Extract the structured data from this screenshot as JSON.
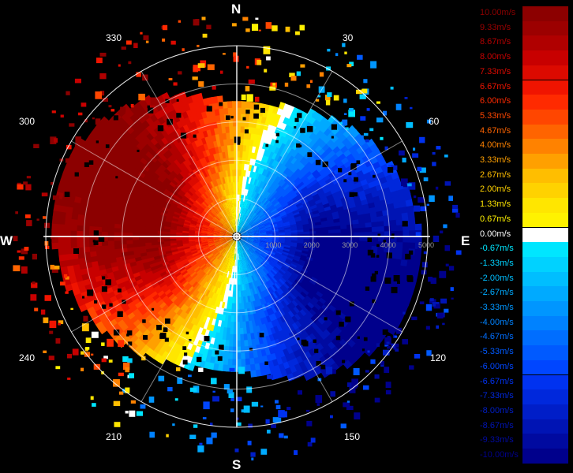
{
  "compass": {
    "north": "N",
    "south": "S",
    "east": "E",
    "west": "W"
  },
  "azimuth_labels": [
    "30",
    "60",
    "120",
    "150",
    "210",
    "240",
    "300",
    "330"
  ],
  "range_labels": [
    "1000",
    "2000",
    "3000",
    "4000",
    "5000"
  ],
  "colorbar": [
    {
      "label": "10.00m/s",
      "color": "#8c0000"
    },
    {
      "label": "9.33m/s",
      "color": "#9c0000"
    },
    {
      "label": "8.67m/s",
      "color": "#b00000"
    },
    {
      "label": "8.00m/s",
      "color": "#c80000"
    },
    {
      "label": "7.33m/s",
      "color": "#dc0a00"
    },
    {
      "label": "6.67m/s",
      "color": "#f01400"
    },
    {
      "label": "6.00m/s",
      "color": "#ff2a00"
    },
    {
      "label": "5.33m/s",
      "color": "#ff4600"
    },
    {
      "label": "4.67m/s",
      "color": "#ff6400"
    },
    {
      "label": "4.00m/s",
      "color": "#ff8200"
    },
    {
      "label": "3.33m/s",
      "color": "#ffa000"
    },
    {
      "label": "2.67m/s",
      "color": "#ffbe00"
    },
    {
      "label": "2.00m/s",
      "color": "#ffd200"
    },
    {
      "label": "1.33m/s",
      "color": "#ffe600"
    },
    {
      "label": "0.67m/s",
      "color": "#fff200"
    },
    {
      "label": "0.00m/s",
      "color": "#ffffff"
    },
    {
      "label": "-0.67m/s",
      "color": "#00e6ff"
    },
    {
      "label": "-1.33m/s",
      "color": "#00d2ff"
    },
    {
      "label": "-2.00m/s",
      "color": "#00beff"
    },
    {
      "label": "-2.67m/s",
      "color": "#00aaff"
    },
    {
      "label": "-3.33m/s",
      "color": "#0096ff"
    },
    {
      "label": "-4.00m/s",
      "color": "#0082ff"
    },
    {
      "label": "-4.67m/s",
      "color": "#006eff"
    },
    {
      "label": "-5.33m/s",
      "color": "#005aff"
    },
    {
      "label": "-6.00m/s",
      "color": "#0046ff"
    },
    {
      "label": "-6.67m/s",
      "color": "#0032f0"
    },
    {
      "label": "-7.33m/s",
      "color": "#0028dc"
    },
    {
      "label": "-8.00m/s",
      "color": "#001ec8"
    },
    {
      "label": "-8.67m/s",
      "color": "#0014b4"
    },
    {
      "label": "-9.33m/s",
      "color": "#000aa0"
    },
    {
      "label": "-10.00m/s",
      "color": "#00008c"
    }
  ]
}
